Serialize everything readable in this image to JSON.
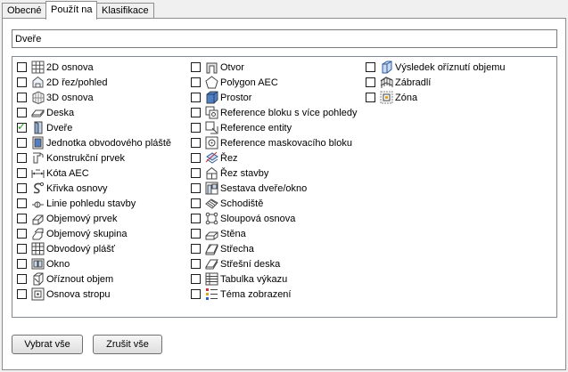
{
  "tabs": [
    {
      "label": "Obecné",
      "active": false
    },
    {
      "label": "Použít na",
      "active": true
    },
    {
      "label": "Klasifikace",
      "active": false
    }
  ],
  "name_field": {
    "value": "Dveře"
  },
  "columns": [
    [
      {
        "label": "2D osnova",
        "icon": "2d-grid-icon",
        "checked": false
      },
      {
        "label": "2D řez/pohled",
        "icon": "2d-section-icon",
        "checked": false
      },
      {
        "label": "3D osnova",
        "icon": "3d-grid-icon",
        "checked": false
      },
      {
        "label": "Deska",
        "icon": "slab-icon",
        "checked": false
      },
      {
        "label": "Dveře",
        "icon": "door-icon",
        "checked": true
      },
      {
        "label": "Jednotka obvodového pláště",
        "icon": "curtain-wall-unit-icon",
        "checked": false
      },
      {
        "label": "Konstrukční prvek",
        "icon": "structural-member-icon",
        "checked": false
      },
      {
        "label": "Kóta AEC",
        "icon": "aec-dimension-icon",
        "checked": false
      },
      {
        "label": "Křivka osnovy",
        "icon": "grid-curve-icon",
        "checked": false
      },
      {
        "label": "Linie pohledu stavby",
        "icon": "building-view-line-icon",
        "checked": false
      },
      {
        "label": "Objemový prvek",
        "icon": "mass-element-icon",
        "checked": false
      },
      {
        "label": "Objemový skupina",
        "icon": "mass-group-icon",
        "checked": false
      },
      {
        "label": "Obvodový plášť",
        "icon": "curtain-wall-icon",
        "checked": false
      },
      {
        "label": "Okno",
        "icon": "window-icon",
        "checked": false
      },
      {
        "label": "Oříznout objem",
        "icon": "clip-volume-icon",
        "checked": false
      },
      {
        "label": "Osnova stropu",
        "icon": "ceiling-grid-icon",
        "checked": false
      }
    ],
    [
      {
        "label": "Otvor",
        "icon": "opening-icon",
        "checked": false
      },
      {
        "label": "Polygon AEC",
        "icon": "aec-polygon-icon",
        "checked": false
      },
      {
        "label": "Prostor",
        "icon": "space-icon",
        "checked": false
      },
      {
        "label": "Reference bloku s více pohledy",
        "icon": "multi-view-block-icon",
        "checked": false
      },
      {
        "label": "Reference entity",
        "icon": "entity-reference-icon",
        "checked": false
      },
      {
        "label": "Reference maskovacího bloku",
        "icon": "mask-block-icon",
        "checked": false
      },
      {
        "label": "Řez",
        "icon": "section-icon",
        "checked": false
      },
      {
        "label": "Řez stavby",
        "icon": "building-section-icon",
        "checked": false
      },
      {
        "label": "Sestava dveře/okno",
        "icon": "door-window-assembly-icon",
        "checked": false
      },
      {
        "label": "Schodiště",
        "icon": "stair-icon",
        "checked": false
      },
      {
        "label": "Sloupová osnova",
        "icon": "column-grid-icon",
        "checked": false
      },
      {
        "label": "Stěna",
        "icon": "wall-icon",
        "checked": false
      },
      {
        "label": "Střecha",
        "icon": "roof-icon",
        "checked": false
      },
      {
        "label": "Střešní deska",
        "icon": "roof-slab-icon",
        "checked": false
      },
      {
        "label": "Tabulka výkazu",
        "icon": "schedule-table-icon",
        "checked": false
      },
      {
        "label": "Téma zobrazení",
        "icon": "display-theme-icon",
        "checked": false
      }
    ],
    [
      {
        "label": "Výsledek oříznutí objemu",
        "icon": "clip-result-icon",
        "checked": false
      },
      {
        "label": "Zábradlí",
        "icon": "railing-icon",
        "checked": false
      },
      {
        "label": "Zóna",
        "icon": "zone-icon",
        "checked": false
      }
    ]
  ],
  "buttons": {
    "select_all": "Vybrat vše",
    "clear_all": "Zrušit vše"
  }
}
